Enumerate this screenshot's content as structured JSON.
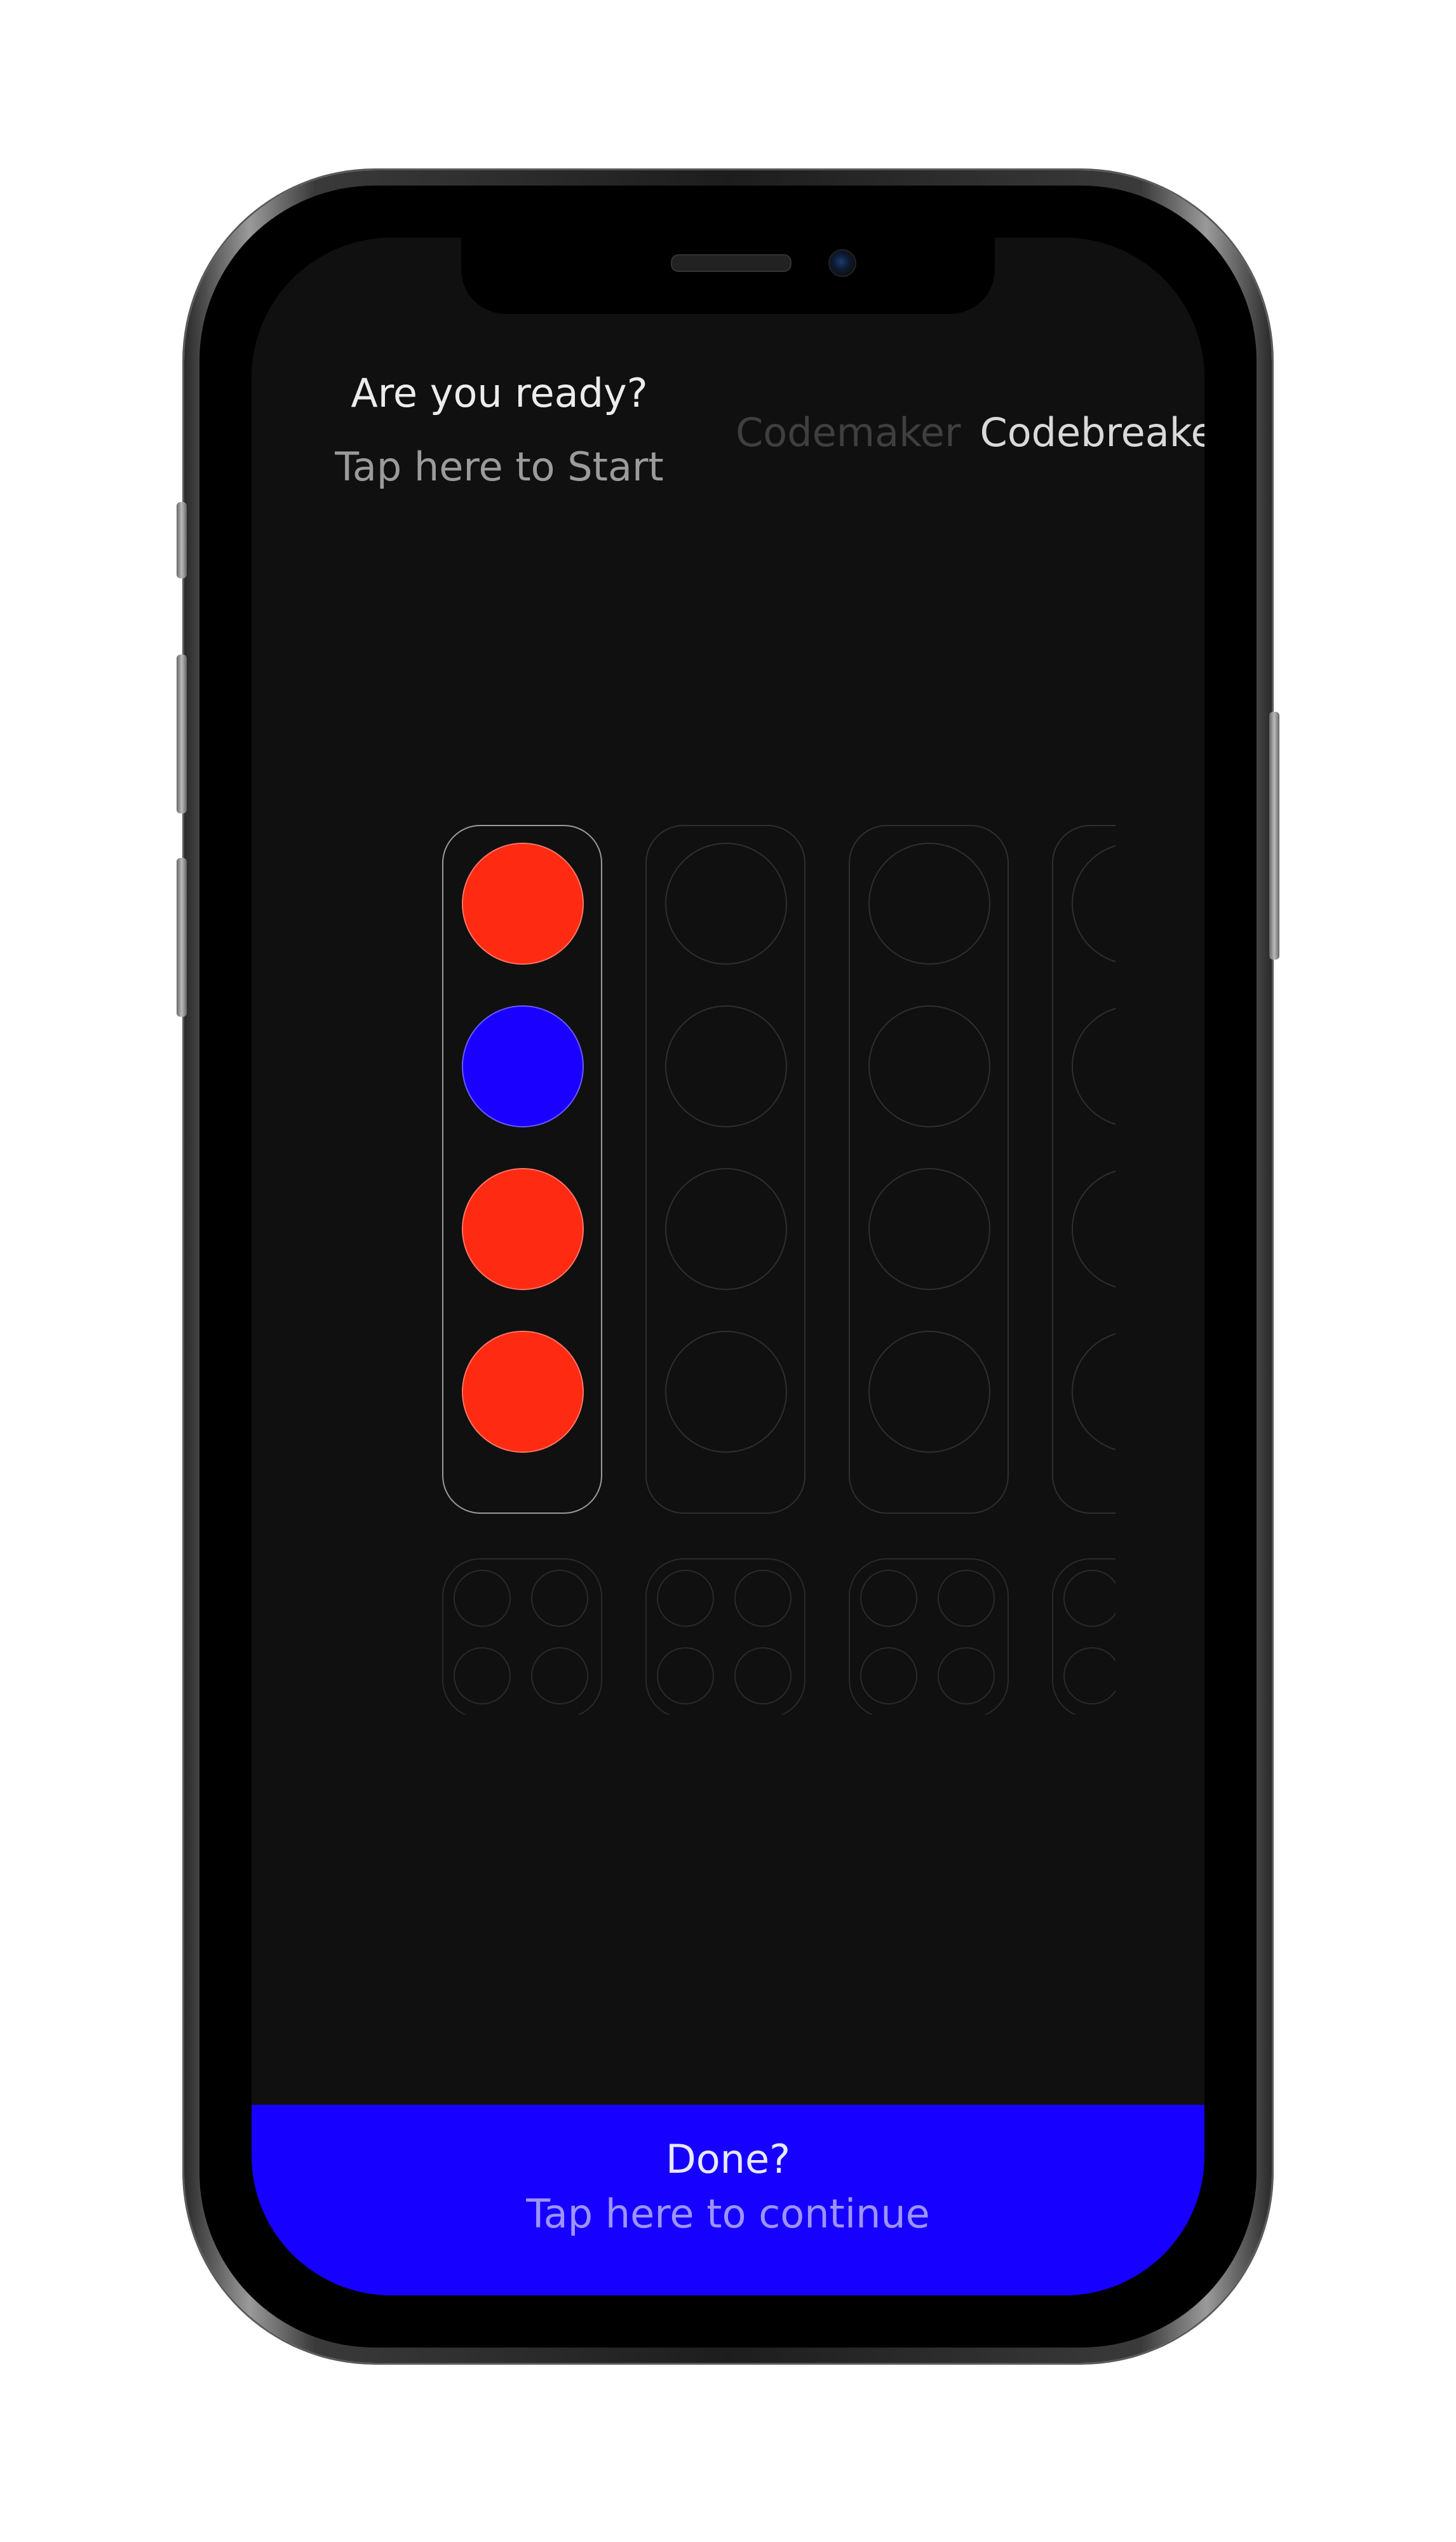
{
  "header": {
    "ready_title": "Are you ready?",
    "ready_subtitle": "Tap here to Start"
  },
  "mode_switch": {
    "codemaker_label": "Codemaker",
    "codebreaker_label": "Codebreaker",
    "selected": "Codebreaker"
  },
  "board": {
    "guess_columns": [
      {
        "pegs": [
          "#ff2a12",
          "#1a00ff",
          "#ff2a12",
          "#ff2a12"
        ],
        "active": true
      },
      {
        "pegs": [
          null,
          null,
          null,
          null
        ],
        "active": false
      },
      {
        "pegs": [
          null,
          null,
          null,
          null
        ],
        "active": false
      },
      {
        "pegs": [
          null,
          null,
          null,
          null
        ],
        "active": false
      }
    ],
    "feedback_columns": 4
  },
  "colors": {
    "background": "#101010",
    "accent": "#1600ff",
    "peg_red": "#ff2a12",
    "peg_blue": "#1a00ff"
  },
  "footer": {
    "done_title": "Done?",
    "done_subtitle": "Tap here to continue"
  }
}
